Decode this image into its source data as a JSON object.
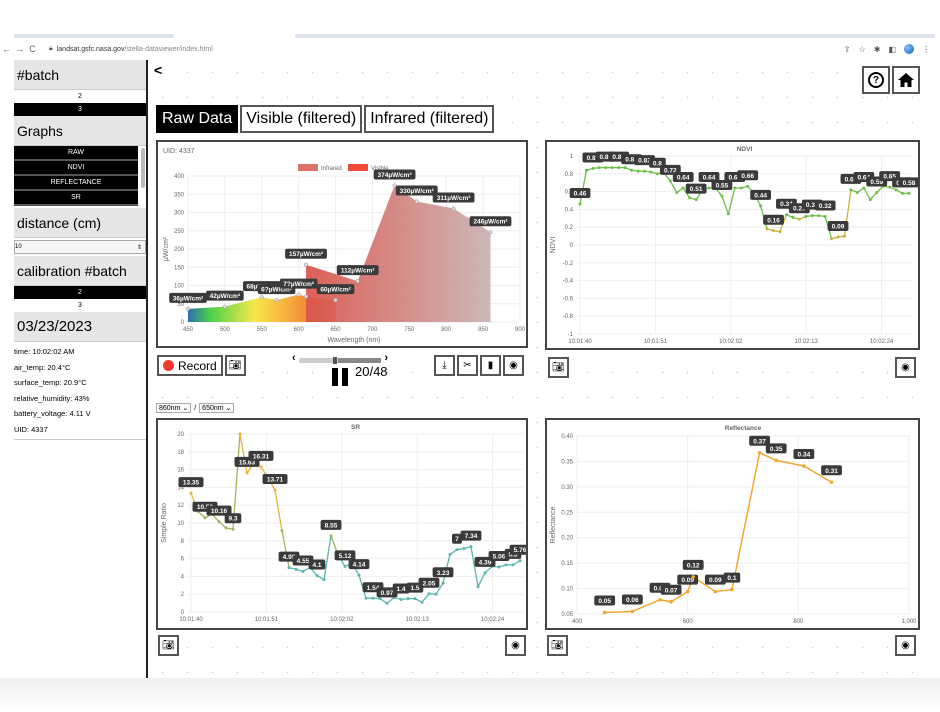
{
  "browser": {
    "url_host": "landsat.gsfc.nasa.gov",
    "url_path": "/stella-dataviewer/index.html",
    "nav": [
      "←",
      "→",
      "C"
    ]
  },
  "sidebar": {
    "batch_heading": "#batch",
    "batch_options": [
      {
        "label": "2",
        "selected": false
      },
      {
        "label": "3",
        "selected": true
      }
    ],
    "graphs_heading": "Graphs",
    "graphs": [
      "RAW",
      "NDVI",
      "REFLECTANCE",
      "SR"
    ],
    "distance_heading": "distance (cm)",
    "distance_value": "10",
    "calibration_heading": "calibration #batch",
    "calibration_options": [
      {
        "label": "2",
        "selected": true
      },
      {
        "label": "3",
        "selected": false
      }
    ],
    "date": "03/23/2023",
    "info": [
      "time: 10:02:02 AM",
      "air_temp: 20.4°C",
      "surface_temp: 20.9°C",
      "relative_humidity: 43%",
      "battery_voltage: 4.11 V",
      "UID: 4337"
    ]
  },
  "main": {
    "collapse_label": "<",
    "help_icon": "?",
    "home_icon": "⌂",
    "tabs": [
      {
        "label": "Raw Data",
        "active": true
      },
      {
        "label": "Visible (filtered)",
        "active": false
      },
      {
        "label": "Infrared (filtered)",
        "active": false
      }
    ],
    "record_label": "Record",
    "playback": {
      "current": 20,
      "total": 48,
      "label": "20/48",
      "progress": 0.42
    },
    "sr_numerator": "860nm",
    "sr_denominator": "650nm",
    "sr_separator": "/"
  },
  "chart_data": [
    {
      "type": "area",
      "id": "raw",
      "uid_label": "UID: 4337",
      "title": "",
      "xlabel": "Wavelength (nm)",
      "ylabel": "µW/cm²",
      "xlim": [
        450,
        900
      ],
      "ylim": [
        0,
        400
      ],
      "xticks": [
        450,
        500,
        550,
        600,
        650,
        700,
        750,
        800,
        850,
        900
      ],
      "yticks": [
        0,
        50,
        100,
        150,
        200,
        250,
        300,
        350,
        400
      ],
      "legend": [
        "Infrared",
        "Visible"
      ],
      "legend_colors": [
        "#e0706a",
        "#ef4b3b"
      ],
      "legend_position": "top",
      "series": [
        {
          "name": "Visible",
          "x": [
            450,
            500,
            550,
            570,
            600,
            610,
            650
          ],
          "values": [
            36,
            42,
            68,
            60,
            75,
            70,
            60
          ],
          "labels": [
            "36µW/cm²",
            "42µW/cm²",
            "68µW/cm²",
            "6?µW/cm²",
            "7?µW/cm²",
            "",
            "60µW/cm²"
          ]
        },
        {
          "name": "Infrared",
          "x": [
            610,
            680,
            730,
            760,
            810,
            860
          ],
          "values": [
            157,
            112,
            374,
            330,
            311,
            246
          ],
          "labels": [
            "157µW/cm²",
            "112µW/cm²",
            "374µW/cm²",
            "330µW/cm²",
            "311µW/cm²",
            "246µW/cm²"
          ]
        }
      ]
    },
    {
      "type": "line",
      "id": "ndvi",
      "title": "NDVI",
      "xlabel": "",
      "ylabel": "NDVI",
      "ylim": [
        -1.0,
        1.0
      ],
      "yticks": [
        -1.0,
        -0.8,
        -0.6,
        -0.4,
        -0.2,
        0,
        0.2,
        0.4,
        0.6,
        0.8,
        1.0
      ],
      "xticks": [
        "10:01:40",
        "10:01:51",
        "10:02:02",
        "10:02:13",
        "10:02:24"
      ],
      "x_range_seconds": [
        0,
        48
      ],
      "values": [
        0.46,
        0.84,
        0.86,
        0.87,
        0.87,
        0.87,
        0.87,
        0.87,
        0.84,
        0.83,
        0.83,
        0.82,
        0.8,
        0.81,
        0.72,
        0.59,
        0.64,
        0.53,
        0.51,
        0.62,
        0.64,
        0.64,
        0.55,
        0.35,
        0.64,
        0.64,
        0.66,
        0.58,
        0.44,
        0.18,
        0.16,
        0.15,
        0.34,
        0.31,
        0.29,
        0.32,
        0.33,
        0.33,
        0.32,
        0.07,
        0.09,
        0.1,
        0.62,
        0.59,
        0.64,
        0.51,
        0.59,
        0.66,
        0.65,
        0.62,
        0.58,
        0.58
      ],
      "line_color": "#6cc04a"
    },
    {
      "type": "line",
      "id": "sr",
      "title": "SR",
      "xlabel": "",
      "ylabel": "Simple Ratio",
      "ylim": [
        0,
        20
      ],
      "yticks": [
        0,
        2,
        4,
        6,
        8,
        10,
        12,
        14,
        16,
        18,
        20
      ],
      "xticks": [
        "10:01:40",
        "10:01:51",
        "10:02:02",
        "10:02:13",
        "10:02:24"
      ],
      "x_range_seconds": [
        0,
        48
      ],
      "values": [
        13.35,
        11.3,
        10.59,
        11.0,
        10.16,
        9.45,
        9.3,
        20,
        15.63,
        16.72,
        16.31,
        15.1,
        13.71,
        9.14,
        4.98,
        4.8,
        4.55,
        5.01,
        4.1,
        3.64,
        8.55,
        6.45,
        5.12,
        5.5,
        4.14,
        1.55,
        1.54,
        1.5,
        0.97,
        1.63,
        1.4,
        1.5,
        1.5,
        1.1,
        2.05,
        2.0,
        3.23,
        6.49,
        7.0,
        7.13,
        7.34,
        2.84,
        4.39,
        5.13,
        5.06,
        5.3,
        5.3,
        5.76
      ],
      "line_color": "#5bb5ad"
    },
    {
      "type": "line",
      "id": "reflectance",
      "title": "Reflectance",
      "xlabel": "",
      "ylabel": "Reflectance",
      "xlim": [
        400,
        1000
      ],
      "ylim": [
        0.05,
        0.4
      ],
      "xticks": [
        400,
        600,
        800,
        1000
      ],
      "xtick_labels": [
        "400",
        "600",
        "800",
        "1,000"
      ],
      "yticks": [
        0.05,
        0.1,
        0.15,
        0.2,
        0.25,
        0.3,
        0.35,
        0.4
      ],
      "x": [
        450,
        500,
        550,
        570,
        600,
        610,
        650,
        680,
        730,
        760,
        810,
        860
      ],
      "values": [
        0.053,
        0.055,
        0.078,
        0.074,
        0.094,
        0.123,
        0.094,
        0.098,
        0.367,
        0.352,
        0.341,
        0.309
      ],
      "labels": [
        "0.05",
        "0.06",
        "0.08",
        "0.07",
        "0.09",
        "0.12",
        "0.09",
        "0.1",
        "0.37",
        "0.35",
        "0.34",
        "0.31"
      ],
      "line_color": "#f0a830"
    }
  ]
}
